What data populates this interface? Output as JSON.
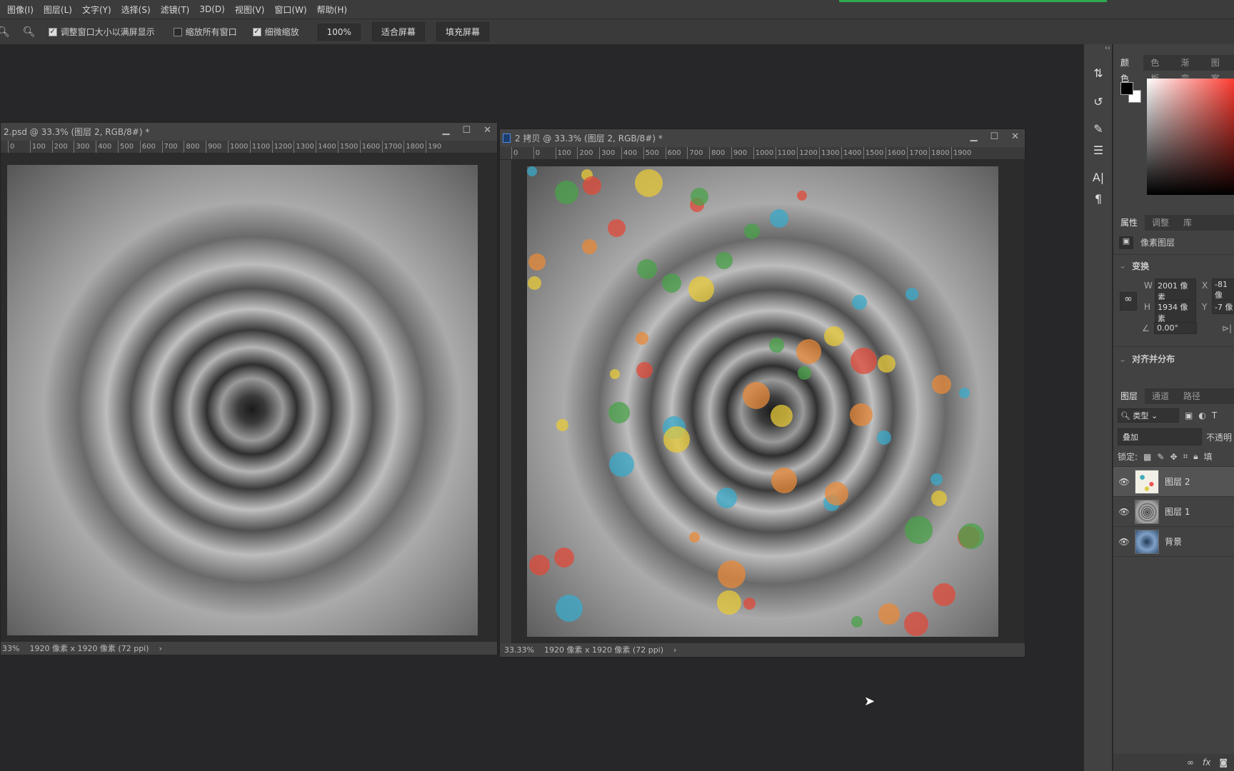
{
  "menu": [
    "图像(I)",
    "图层(L)",
    "文字(Y)",
    "选择(S)",
    "滤镜(T)",
    "3D(D)",
    "视图(V)",
    "窗口(W)",
    "帮助(H)"
  ],
  "options": {
    "resize_windows": {
      "label": "调整窗口大小以满屏显示",
      "checked": true
    },
    "zoom_all": {
      "label": "缩放所有窗口",
      "checked": false
    },
    "scrubby_zoom": {
      "label": "细微缩放",
      "checked": true
    },
    "zoom_value": "100%",
    "fit_screen": "适合屏幕",
    "fill_screen": "填充屏幕"
  },
  "doc_left": {
    "title": "2.psd @ 33.3% (图层 2, RGB/8#) *",
    "ruler": [
      "0",
      "100",
      "200",
      "300",
      "400",
      "500",
      "600",
      "700",
      "800",
      "900",
      "1000",
      "1100",
      "1200",
      "1300",
      "1400",
      "1500",
      "1600",
      "1700",
      "1800",
      "190"
    ],
    "zoom": "33%",
    "info": "1920 像素 x 1920 像素 (72 ppi)"
  },
  "doc_right": {
    "title": "2 拷贝 @ 33.3% (图层 2, RGB/8#) *",
    "ruler": [
      "0",
      "0",
      "100",
      "200",
      "300",
      "400",
      "500",
      "600",
      "700",
      "800",
      "900",
      "1000",
      "1100",
      "1200",
      "1300",
      "1400",
      "1500",
      "1600",
      "1700",
      "1800",
      "1900"
    ],
    "zoom": "33.33%",
    "info": "1920 像素 x 1920 像素 (72 ppi)"
  },
  "color_panel": {
    "tabs": [
      "颜色",
      "色板",
      "渐变",
      "图案"
    ],
    "foreground": "#000000",
    "background": "#ffffff",
    "hue": "#ff3b30"
  },
  "properties": {
    "tabs": [
      "属性",
      "调整",
      "库"
    ],
    "layer_type": "像素图层",
    "transform_label": "变换",
    "w_label": "W",
    "w": "2001 像素",
    "h_label": "H",
    "h": "1934 像素",
    "x_label": "X",
    "x": "-81 像",
    "y_label": "Y",
    "y": "-7 像",
    "angle": "0.00°",
    "align_label": "对齐并分布"
  },
  "layers": {
    "tabs": [
      "图层",
      "通道",
      "路径"
    ],
    "filter": "类型",
    "blend_mode": "叠加",
    "opacity_label": "不透明",
    "lock_label": "锁定:",
    "fill_label": "填",
    "items": [
      {
        "name": "图层 2",
        "selected": true
      },
      {
        "name": "图层 1",
        "selected": false
      },
      {
        "name": "背景",
        "selected": false
      }
    ]
  }
}
